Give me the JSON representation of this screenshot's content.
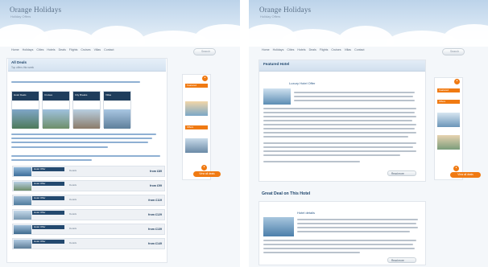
{
  "left_page": {
    "title": "Orange Holidays",
    "tagline": "Holiday Offers",
    "nav": [
      "Home",
      "Holidays",
      "Cities",
      "Hotels",
      "Deals",
      "Flights",
      "Cruises",
      "Villas",
      "Contact"
    ],
    "search_label": "Search",
    "panel_title": "All Deals",
    "panel_sub": "Top offers this week",
    "cards": [
      {
        "label": "Hotel Deals"
      },
      {
        "label": "Cruises"
      },
      {
        "label": "City Breaks"
      },
      {
        "label": "Villas"
      }
    ],
    "rows": [
      {
        "name": "Hotel Offer",
        "sub": "Details",
        "price": "from £89"
      },
      {
        "name": "Hotel Offer",
        "sub": "Details",
        "price": "from £99"
      },
      {
        "name": "Hotel Offer",
        "sub": "Details",
        "price": "from £119"
      },
      {
        "name": "Hotel Offer",
        "sub": "Details",
        "price": "from £129"
      },
      {
        "name": "Hotel Offer",
        "sub": "Details",
        "price": "from £139"
      },
      {
        "name": "Hotel Offer",
        "sub": "Details",
        "price": "from £149"
      }
    ],
    "sidebar": {
      "bar1": "Featured",
      "bar2": "Offers",
      "button": "View all deals"
    }
  },
  "right_page": {
    "title": "Orange Holidays",
    "tagline": "Holiday Offers",
    "nav": [
      "Home",
      "Holidays",
      "Cities",
      "Hotels",
      "Deals",
      "Flights",
      "Cruises",
      "Villas",
      "Contact"
    ],
    "search_label": "Search",
    "article1": {
      "title": "Featured Hotel",
      "subtitle": "Luxury Hotel Offer",
      "more": "Read more"
    },
    "article2": {
      "title": "Great Deal on This Hotel",
      "subtitle": "Hotel details",
      "more": "Read more"
    },
    "sidebar": {
      "bar1": "Featured",
      "bar2": "Offers",
      "button": "View all deals"
    }
  },
  "colors": {
    "accent": "#f07a12",
    "brand_dark": "#1f3d5c",
    "header_sky": "#bcd3ea"
  }
}
